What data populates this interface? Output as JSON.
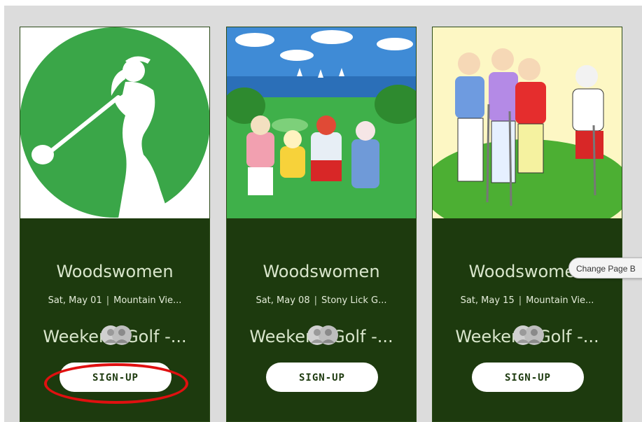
{
  "events": [
    {
      "title_line1": "Woodswomen",
      "title_line2": "Weekend Golf -...",
      "date": "Sat, May 01",
      "location": "Mountain Vie...",
      "signup_label": "SIGN-UP",
      "image_icon": "golfer-silhouette-icon"
    },
    {
      "title_line1": "Woodswomen",
      "title_line2": "Weekend Golf -...",
      "date": "Sat, May 08",
      "location": "Stony Lick G...",
      "signup_label": "SIGN-UP",
      "image_icon": "golf-painting-image"
    },
    {
      "title_line1": "Woodswomen",
      "title_line2": "Weekend Golf -...",
      "date": "Sat, May 15",
      "location": "Mountain Vie...",
      "signup_label": "SIGN-UP",
      "image_icon": "golf-cartoon-image"
    }
  ],
  "tooltip": {
    "text": "Change Page B"
  },
  "colors": {
    "card_bg": "#1d3a0e",
    "panel_bg": "#dcdcdc",
    "circle_green": "#3aa648",
    "highlight": "#e01010"
  }
}
